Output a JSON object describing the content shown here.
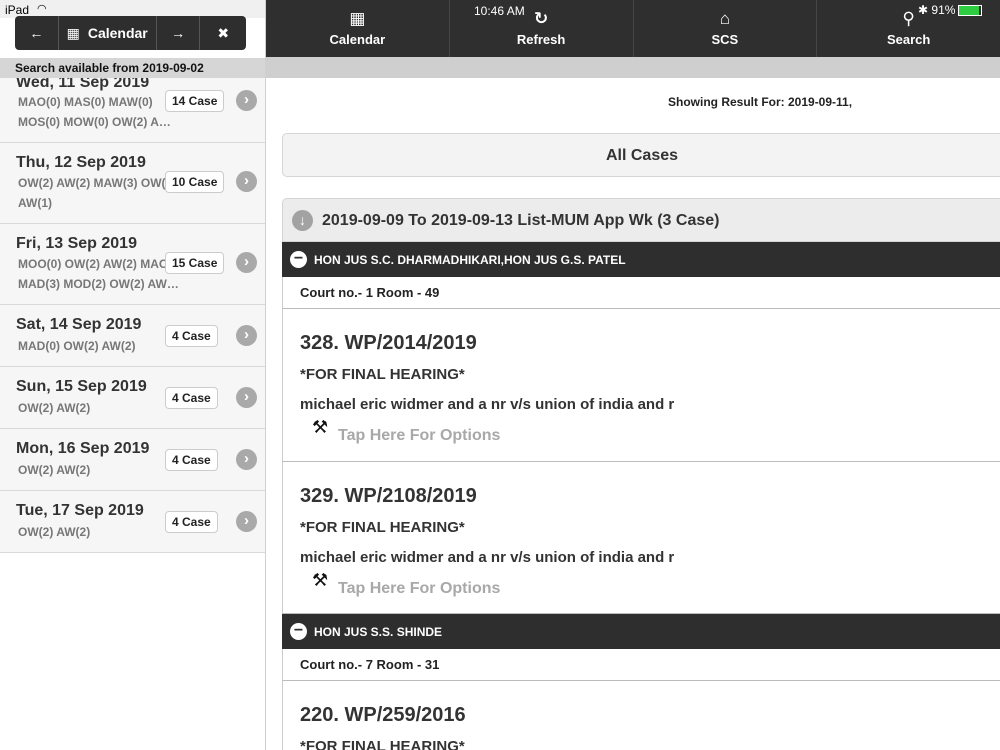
{
  "status_bar": {
    "carrier": "iPad",
    "time": "10:46 AM",
    "battery": "91%"
  },
  "left_toolbar": {
    "calendar_label": "Calendar"
  },
  "search_banner": "Search available from 2019-09-02",
  "days": [
    {
      "date": "Wed, 11 Sep 2019",
      "codes": "MAO(0) MAS(0) MAW(0) MOS(0) MOW(0) OW(2) A…",
      "count": "14 Case"
    },
    {
      "date": "Thu, 12 Sep 2019",
      "codes": "OW(2) AW(2) MAW(3) OW(2) AW(1)",
      "count": "10 Case"
    },
    {
      "date": "Fri, 13 Sep 2019",
      "codes": "MOO(0) OW(2) AW(2) MAO(0) MAD(3) MOD(2) OW(2) AW…",
      "count": "15 Case"
    },
    {
      "date": "Sat, 14 Sep 2019",
      "codes": "MAD(0) OW(2) AW(2)",
      "count": "4 Case"
    },
    {
      "date": "Sun, 15 Sep 2019",
      "codes": "OW(2) AW(2)",
      "count": "4 Case"
    },
    {
      "date": "Mon, 16 Sep 2019",
      "codes": "OW(2) AW(2)",
      "count": "4 Case"
    },
    {
      "date": "Tue, 17 Sep 2019",
      "codes": "OW(2) AW(2)",
      "count": "4 Case"
    }
  ],
  "navbar": {
    "items": [
      {
        "label": "Calendar",
        "icon": "calendar-grid-icon"
      },
      {
        "label": "Refresh",
        "icon": "refresh-icon"
      },
      {
        "label": "SCS",
        "icon": "home-icon"
      },
      {
        "label": "Search",
        "icon": "search-icon"
      }
    ]
  },
  "showing": "Showing Result For: 2019-09-11,",
  "all_cases": "All Cases",
  "list_header": "2019-09-09 To 2019-09-13 List-MUM App Wk (3 Case)",
  "benches": [
    {
      "judges": "HON JUS S.C. DHARMADHIKARI,HON JUS G.S. PATEL",
      "court": "Court no.- 1 Room - 49",
      "cases": [
        {
          "number": "328. WP/2014/2019",
          "stage": "*FOR FINAL HEARING*",
          "parties": "michael eric widmer and a nr v/s union of india and r",
          "options": "Tap Here For Options"
        },
        {
          "number": "329. WP/2108/2019",
          "stage": "*FOR FINAL HEARING*",
          "parties": "michael eric widmer and a nr v/s union of india and r",
          "options": "Tap Here For Options"
        }
      ]
    },
    {
      "judges": "HON JUS S.S. SHINDE",
      "court": "Court no.- 7 Room - 31",
      "cases": [
        {
          "number": "220. WP/259/2016",
          "stage": "*FOR FINAL HEARING*"
        }
      ]
    }
  ]
}
